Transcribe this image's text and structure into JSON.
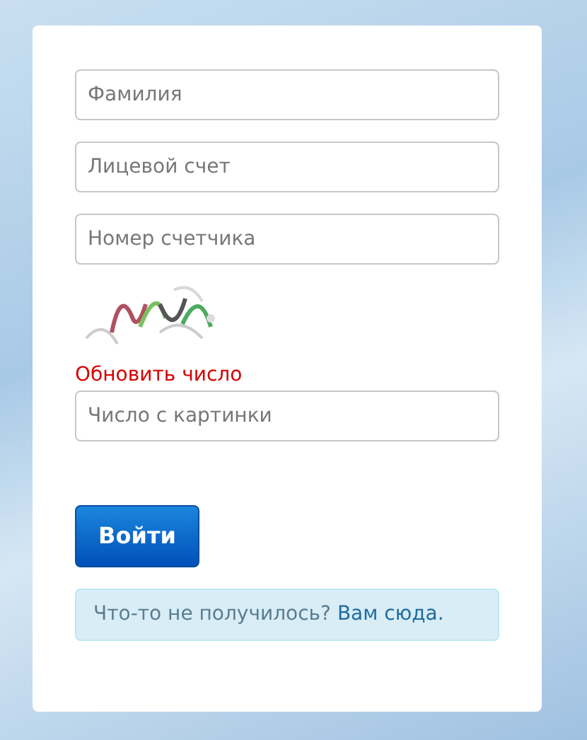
{
  "form": {
    "fields": [
      {
        "placeholder": "Фамилия"
      },
      {
        "placeholder": "Лицевой счет"
      },
      {
        "placeholder": "Номер счетчика"
      }
    ],
    "captcha": {
      "kind": "picture",
      "refresh_link": "Обновить число",
      "input": {
        "placeholder": "Число с картинки"
      }
    },
    "submit_button": "Войти",
    "help": {
      "text": "Что-то не получилось?",
      "link": "Вам сюда."
    }
  }
}
